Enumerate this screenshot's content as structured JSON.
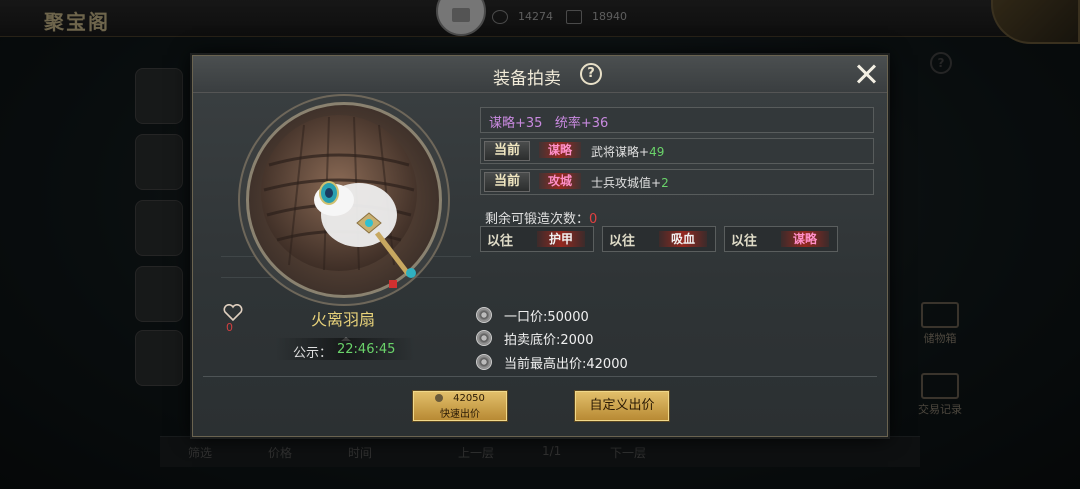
{
  "background": {
    "title": "聚宝阁",
    "currency1": "14274",
    "currency2": "18940",
    "side_right": [
      "储物箱",
      "交易记录"
    ],
    "bottom": {
      "filter": "筛选",
      "price": "价格",
      "time": "时间",
      "prev": "上一层",
      "page": "1/1",
      "next": "下一层"
    }
  },
  "dialog": {
    "title": "装备拍卖",
    "item_name": "火离羽扇",
    "favorites": "0",
    "notice_label": "公示：",
    "notice_time": "22:46:45",
    "bonus": "谋略+35   统率+36",
    "current_label": "当前",
    "current": [
      {
        "attr": "谋略",
        "attr_color": "#ff8fc8",
        "desc": "武将谋略+",
        "value": "49"
      },
      {
        "attr": "攻城",
        "attr_color": "#ff8fc8",
        "desc": "士兵攻城值+",
        "value": "2"
      }
    ],
    "forge_label": "剩余可锻造次数：",
    "forge_count": "0",
    "history_label": "以往",
    "history": [
      {
        "attr": "护甲",
        "color": "#f0f0f0"
      },
      {
        "attr": "吸血",
        "color": "#f0f0f0"
      },
      {
        "attr": "谋略",
        "color": "#ff8fc8"
      }
    ],
    "prices": [
      "一口价:50000",
      "拍卖底价:2000",
      "当前最高出价:42000"
    ],
    "quick_bid": {
      "amount": "42050",
      "label": "快速出价"
    },
    "custom_bid": "自定义出价"
  }
}
